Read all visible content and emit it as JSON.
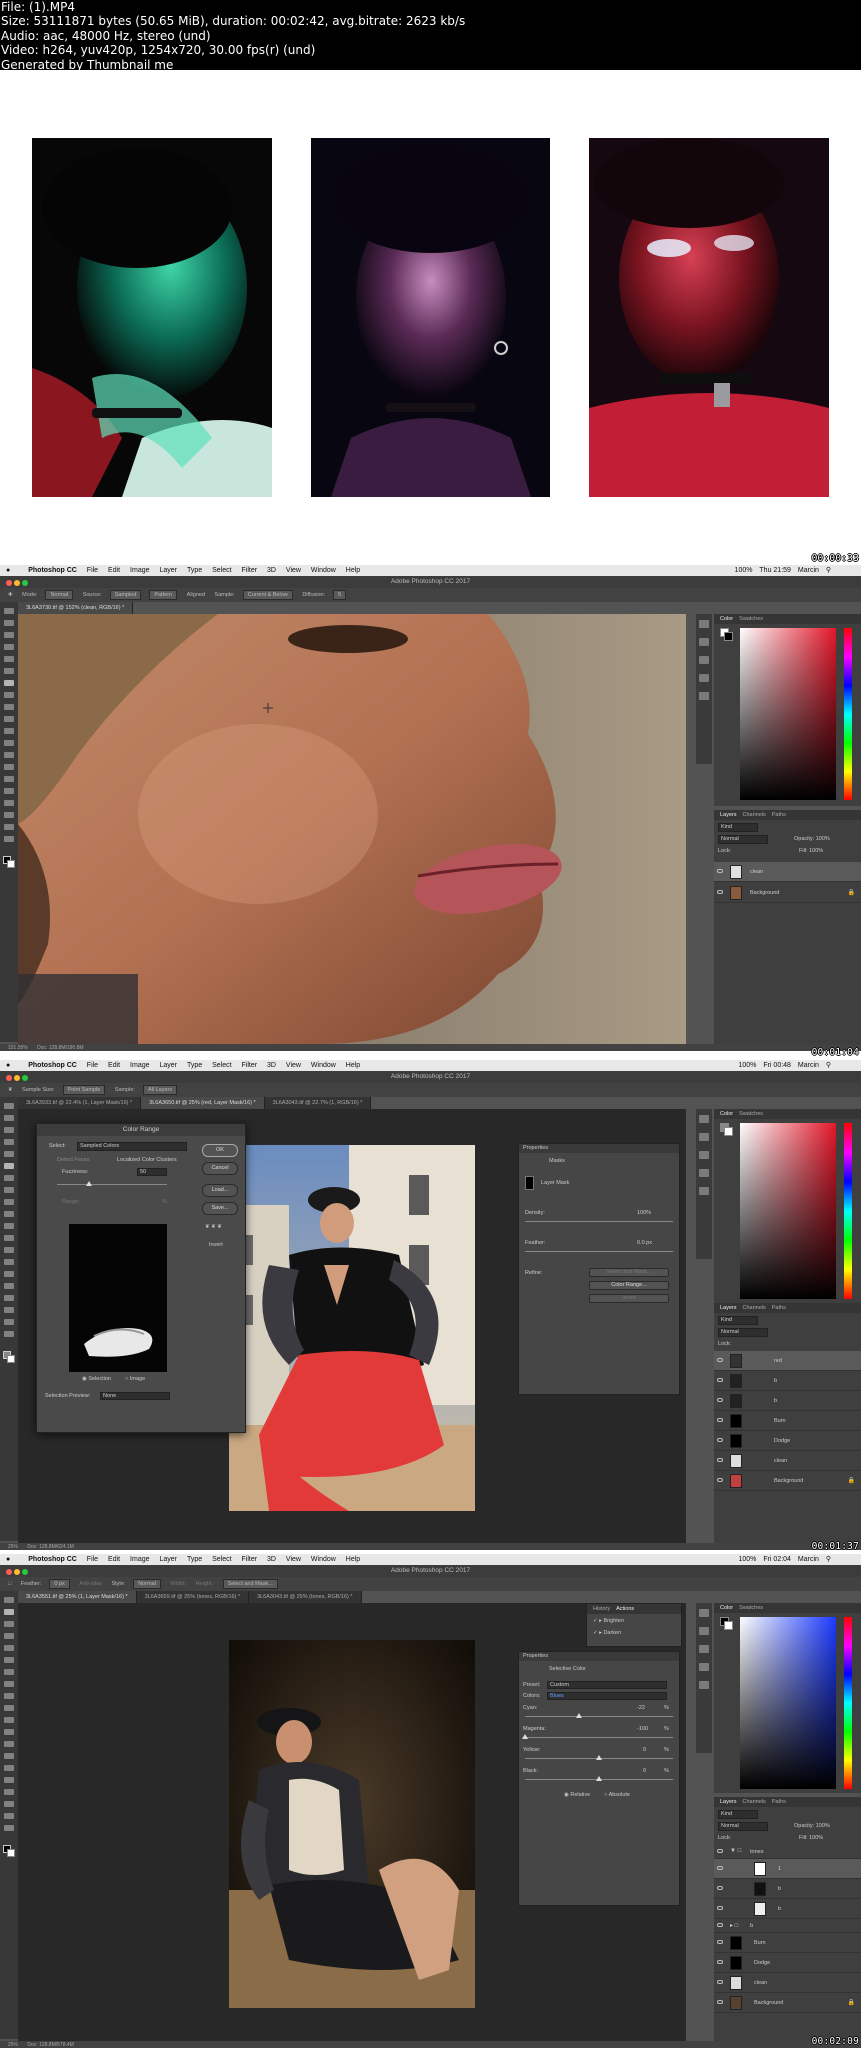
{
  "info": {
    "lines": [
      "File: (1).MP4",
      "Size: 53111871 bytes (50.65 MiB), duration: 00:02:42, avg.bitrate: 2623 kb/s",
      "Audio: aac, 48000 Hz, stereo (und)",
      "Video: h264, yuv420p, 1254x720, 30.00 fps(r) (und)",
      "Generated by Thumbnail me"
    ]
  },
  "timestamps": [
    "00:00:33",
    "00:01:04",
    "00:01:37",
    "00:02:09"
  ],
  "common": {
    "app_name": "Photoshop CC",
    "apple": "",
    "menus": [
      "File",
      "Edit",
      "Image",
      "Layer",
      "Type",
      "Select",
      "Filter",
      "3D",
      "View",
      "Window",
      "Help"
    ],
    "window_title": "Adobe Photoshop CC 2017",
    "battery": "100%",
    "user": "Marcin",
    "panel_tabs_top": [
      "Color",
      "Swatches"
    ],
    "panel_tabs_layers": [
      "Layers",
      "Channels",
      "Paths"
    ],
    "kind": "Kind",
    "normal": "Normal",
    "opacity": "Opacity: 100%",
    "fill": "Fill: 100%",
    "lock": "Lock:"
  },
  "frame1": {
    "clock": "Thu 21:59",
    "options": {
      "mode_label": "Mode:",
      "mode_value": "Normal",
      "source_label": "Source:",
      "sampled": "Sampled",
      "pattern": "Pattern",
      "aligned": "Aligned",
      "sample_label": "Sample:",
      "sample_value": "Current & Below",
      "diffusion_label": "Diffusion:",
      "diffusion_value": "5"
    },
    "tab": "3L6A3730.tif @ 152% (clean, RGB/16) *",
    "status_zoom": "151.55%",
    "status_doc": "Doc: 128.8M/190.8M",
    "layers": [
      "clean",
      "Background"
    ]
  },
  "frame2": {
    "clock": "Fri 00:48",
    "options": {
      "sample_size_label": "Sample Size:",
      "sample_size_value": "Point Sample",
      "sample_label": "Sample:",
      "sample_value": "All Layers"
    },
    "tabs": [
      "3L6A3933.tif @ 22.4% (1, Layer Mask/16) *",
      "3L6A3650.tif @ 25% (red, Layer Mask/16) *",
      "3L6A3043.tif @ 22.7% (1, RGB/16) *"
    ],
    "dialog": {
      "title": "Color Range",
      "select_label": "Select:",
      "select_value": "Sampled Colors",
      "detect_faces": "Detect Faces",
      "localized": "Localized Color Clusters",
      "fuzziness_label": "Fuzziness:",
      "fuzziness_value": "50",
      "range_label": "Range:",
      "range_value": "%",
      "ok": "OK",
      "cancel": "Cancel",
      "load": "Load...",
      "save": "Save...",
      "invert": "Invert",
      "selection": "Selection",
      "image": "Image",
      "preview_label": "Selection Preview:",
      "preview_value": "None"
    },
    "properties": {
      "title": "Properties",
      "masks": "Masks",
      "layer_mask": "Layer Mask",
      "density_label": "Density:",
      "density_value": "100%",
      "feather_label": "Feather:",
      "feather_value": "0.0 px",
      "refine_label": "Refine:",
      "select_mask": "Select and Mask...",
      "color_range": "Color Range...",
      "invert": "Invert"
    },
    "status_zoom": "25%",
    "status_doc": "Doc: 128.8M/624.1M",
    "layers": [
      "red",
      "b",
      "b",
      "Burn",
      "Dodge",
      "clean",
      "Background"
    ]
  },
  "frame3": {
    "clock": "Fri 02:04",
    "options": {
      "feather_label": "Feather:",
      "feather_value": "0 px",
      "antialias": "Anti-alias",
      "style_label": "Style:",
      "style_value": "Normal",
      "width_label": "Width:",
      "height_label": "Height:",
      "select_mask": "Select and Mask..."
    },
    "tabs": [
      "3L6A3551.tif @ 25% (1, Layer Mask/16) *",
      "3L6A3659.tif @ 25% (tones, RGB/16) *",
      "3L6A3043.tif @ 25% (tones, RGB/16) *"
    ],
    "history_tabs": [
      "History",
      "Actions"
    ],
    "actions": [
      "Brighten",
      "Darken"
    ],
    "properties": {
      "title": "Properties",
      "panel": "Selective Color",
      "preset_label": "Preset:",
      "preset_value": "Custom",
      "colors_label": "Colors:",
      "colors_value": "Blues",
      "cyan_label": "Cyan:",
      "cyan_value": "-22",
      "magenta_label": "Magenta:",
      "magenta_value": "-100",
      "yellow_label": "Yellow:",
      "yellow_value": "0",
      "black_label": "Black:",
      "black_value": "0",
      "relative": "Relative",
      "absolute": "Absolute",
      "unit": "%"
    },
    "status_zoom": "25%",
    "status_doc": "Doc: 128.8M/578.4M",
    "layers": [
      "tones",
      "1",
      "b",
      "b",
      "b",
      "Burn",
      "Dodge",
      "clean",
      "Background"
    ]
  },
  "colors": {
    "frame_bg": "#535353",
    "panel_bg": "#3f3f3f",
    "canvas_bg": "#282828",
    "close": "#ff5f57",
    "minimize": "#febc2e",
    "maximize": "#28c840"
  }
}
